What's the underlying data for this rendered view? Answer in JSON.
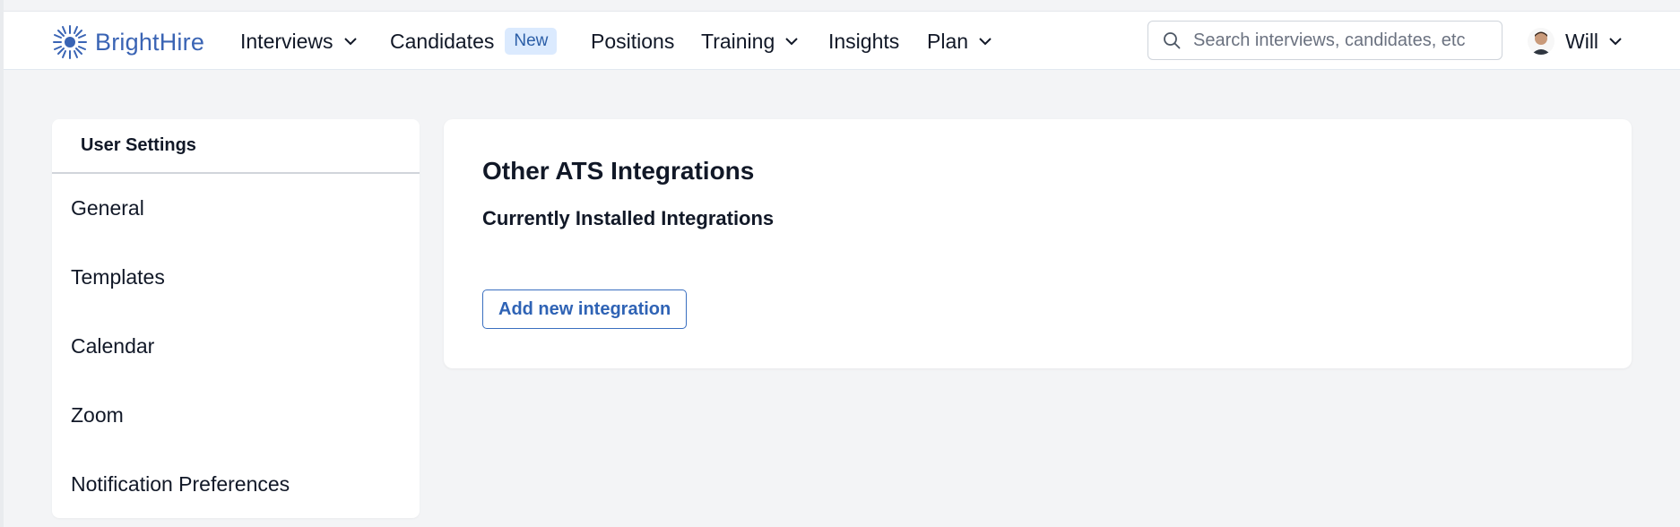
{
  "app": {
    "name": "BrightHire"
  },
  "nav": {
    "items": [
      {
        "label": "Interviews",
        "has_dropdown": true
      },
      {
        "label": "Candidates",
        "badge": "New"
      },
      {
        "label": "Positions"
      },
      {
        "label": "Training",
        "has_dropdown": true
      },
      {
        "label": "Insights"
      },
      {
        "label": "Plan",
        "has_dropdown": true
      }
    ]
  },
  "search": {
    "placeholder": "Search interviews, candidates, etc",
    "value": ""
  },
  "user": {
    "name": "Will"
  },
  "sidebar": {
    "title": "User Settings",
    "items": [
      {
        "label": "General"
      },
      {
        "label": "Templates"
      },
      {
        "label": "Calendar"
      },
      {
        "label": "Zoom"
      },
      {
        "label": "Notification Preferences"
      }
    ]
  },
  "main": {
    "title": "Other ATS Integrations",
    "subtitle": "Currently Installed Integrations",
    "add_button_label": "Add new integration"
  },
  "colors": {
    "brand": "#3a64b4",
    "badge_bg": "#dbeafe",
    "page_bg": "#f3f4f6"
  }
}
